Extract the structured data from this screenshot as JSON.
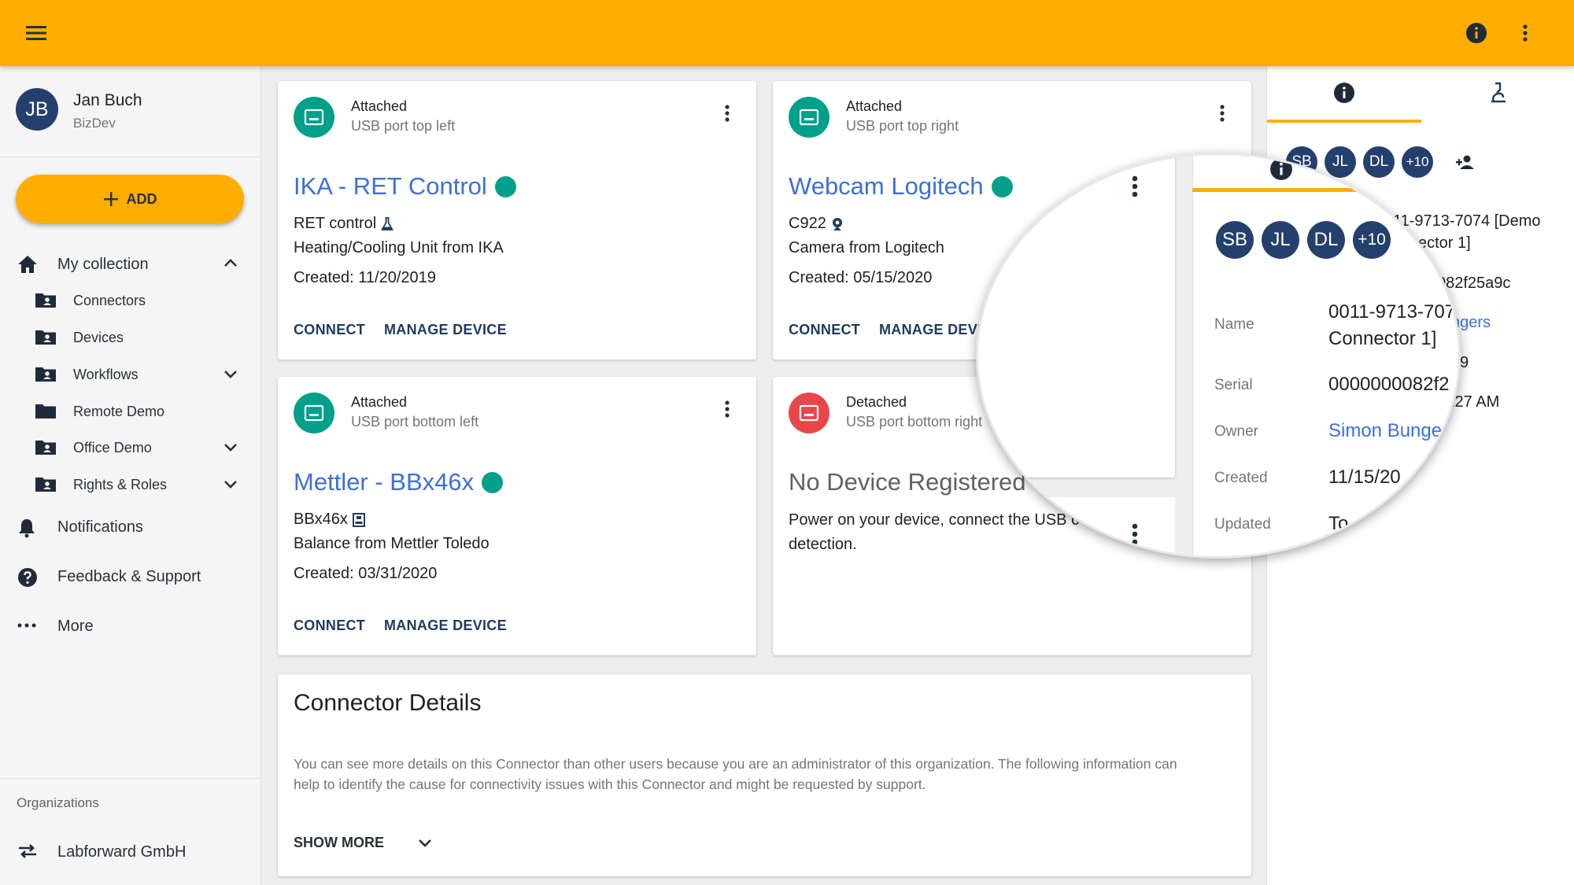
{
  "user": {
    "initials": "JB",
    "name": "Jan Buch",
    "role": "BizDev"
  },
  "sidebar": {
    "add_label": "ADD",
    "collection_label": "My collection",
    "sub_items": [
      {
        "label": "Connectors",
        "icon": "folder-account-icon"
      },
      {
        "label": "Devices",
        "icon": "folder-account-icon"
      },
      {
        "label": "Workflows",
        "icon": "folder-account-icon"
      },
      {
        "label": "Remote Demo",
        "icon": "folder-icon"
      },
      {
        "label": "Office Demo",
        "icon": "folder-account-icon"
      },
      {
        "label": "Rights & Roles",
        "icon": "folder-account-icon"
      }
    ],
    "notifications_label": "Notifications",
    "feedback_label": "Feedback & Support",
    "more_label": "More",
    "organizations_label": "Organizations",
    "org_name": "Labforward GmbH"
  },
  "cards": [
    {
      "status": "Attached",
      "port": "USB port top left",
      "name": "IKA - RET Control",
      "model": "RET control",
      "model_icon": "flask-icon",
      "description": "Heating/Cooling Unit from IKA",
      "created": "Created: 11/20/2019",
      "connect_label": "CONNECT",
      "manage_label": "MANAGE DEVICE"
    },
    {
      "status": "Attached",
      "port": "USB port top right",
      "name": "Webcam Logitech",
      "model": "C922",
      "model_icon": "webcam-icon",
      "description": "Camera from Logitech",
      "created": "Created: 05/15/2020",
      "connect_label": "CONNECT",
      "manage_label": "MANAGE DEVI"
    },
    {
      "status": "Attached",
      "port": "USB port bottom left",
      "name": "Mettler - BBx46x",
      "model": "BBx46x",
      "model_icon": "scale-icon",
      "description": "Balance from Mettler Toledo",
      "created": "Created: 03/31/2020",
      "connect_label": "CONNECT",
      "manage_label": "MANAGE DEVICE"
    },
    {
      "status": "Detached",
      "port": "USB port bottom right",
      "name": "No Device Registered",
      "description_line1": "Power on your device, connect the USB c",
      "description_line2": "detection."
    }
  ],
  "details": {
    "title": "Connector Details",
    "text_line1": "You can see more details on this Connector than other users because you are an administrator of this organization. The following information can",
    "text_line2": "help to identify the cause for connectivity issues with this Connector and might be requested by support.",
    "show_more_label": "SHOW MORE"
  },
  "panel": {
    "members": [
      "SB",
      "JL",
      "DL",
      "+10"
    ],
    "name_partial_1": "11-9713-7074 [Demo",
    "name_partial_2": "ector 1]",
    "serial_partial": "082f25a9c",
    "owner_partial": "ngers",
    "created_partial": "9",
    "updated_partial": ":27 AM"
  },
  "magnifier": {
    "members": [
      "SB",
      "JL",
      "DL",
      "+10"
    ],
    "name_label": "Name",
    "name_value_1": "0011-9713-707",
    "name_value_2": "Connector 1]",
    "serial_label": "Serial",
    "serial_value": "0000000082f2",
    "owner_label": "Owner",
    "owner_value": "Simon Bunge",
    "created_label": "Created",
    "created_value": "11/15/20",
    "updated_label": "Updated",
    "updated_value": "To"
  },
  "colors": {
    "accent": "#ffad00",
    "navy": "#24406c",
    "link": "#3d6fd9",
    "attached": "#00a08a",
    "detached": "#e8474a"
  }
}
